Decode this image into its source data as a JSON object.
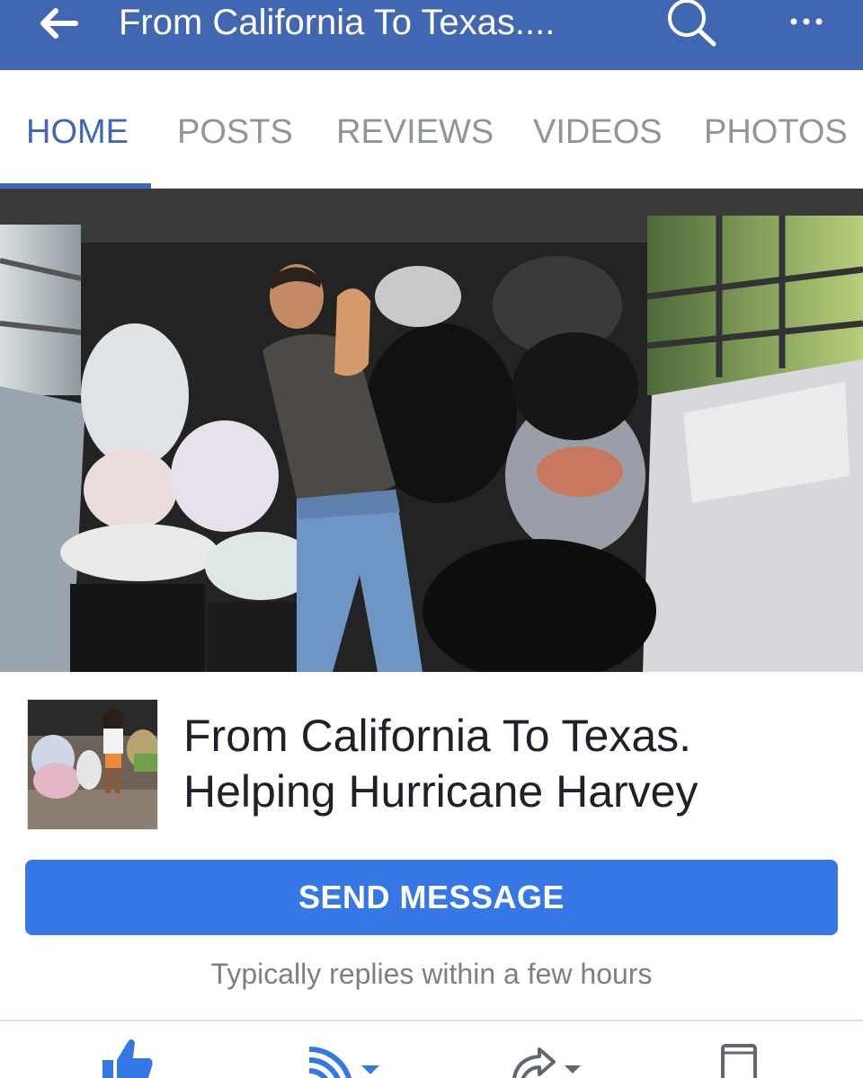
{
  "header": {
    "title": "From California To Texas....",
    "icons": [
      "back-arrow-icon",
      "search-icon",
      "more-icon"
    ],
    "background": "#4267b2"
  },
  "tabs": [
    {
      "label": "HOME",
      "active": true
    },
    {
      "label": "POSTS",
      "active": false
    },
    {
      "label": "REVIEWS",
      "active": false
    },
    {
      "label": "VIDEOS",
      "active": false
    },
    {
      "label": "PHOTOS",
      "active": false
    }
  ],
  "page": {
    "name_line1": "From California To Texas.",
    "name_line2": "Helping Hurricane Harvey"
  },
  "send_button": {
    "label": "SEND MESSAGE",
    "color": "#3578e5"
  },
  "reply_note": "Typically replies within a few hours",
  "actions": [
    "like-icon",
    "follow-icon",
    "share-icon",
    "save-icon"
  ]
}
